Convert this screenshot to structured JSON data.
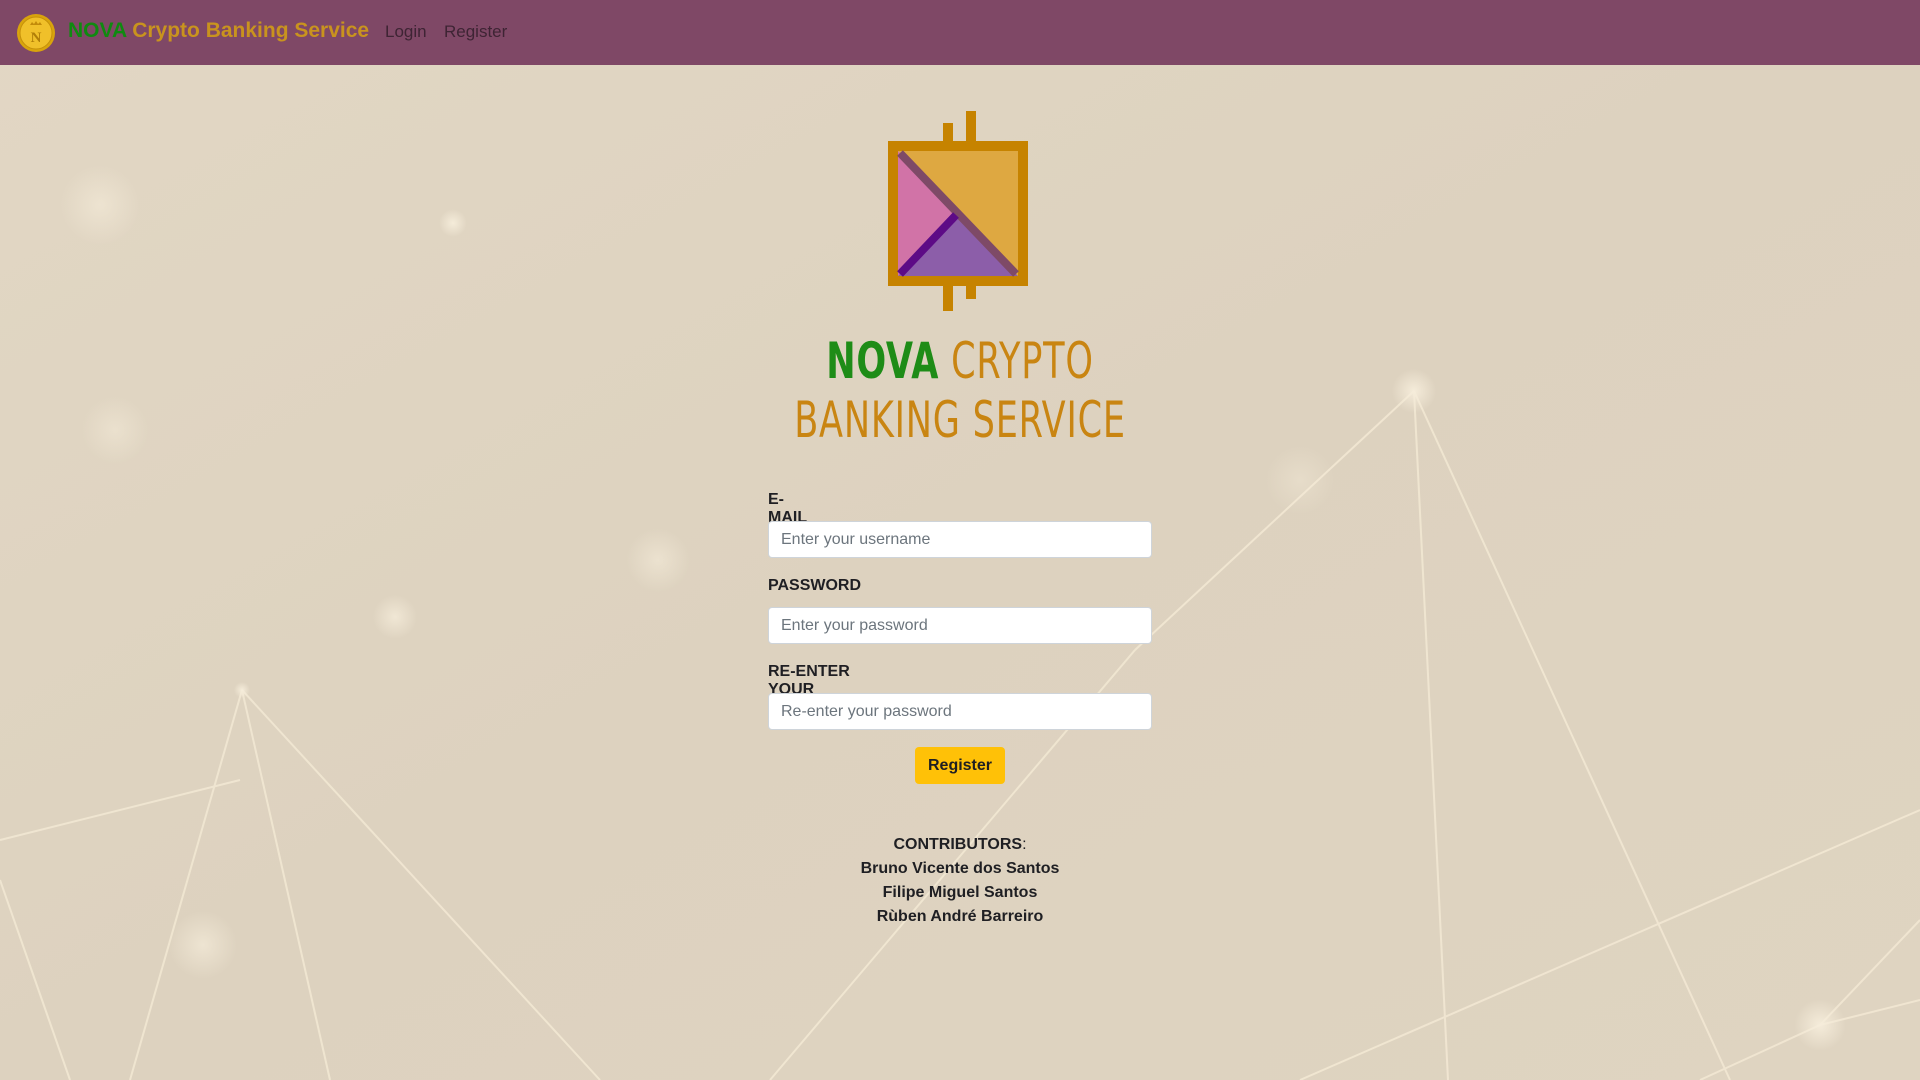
{
  "navbar": {
    "brand_first": "NOVA",
    "brand_rest": "Crypto Banking Service",
    "links": [
      {
        "label": "Login"
      },
      {
        "label": "Register"
      }
    ]
  },
  "hero": {
    "title_first": "NOVA",
    "title_line1_rest": "CRYPTO",
    "title_line2": "BANKING SERVICE"
  },
  "form": {
    "email": {
      "label": "E-MAIL",
      "placeholder": "Enter your username",
      "value": ""
    },
    "password": {
      "label": "PASSWORD",
      "placeholder": "Enter your password",
      "value": ""
    },
    "confirm": {
      "label": "RE-ENTER YOUR PASSWORD",
      "placeholder": "Re-enter your password",
      "value": ""
    },
    "submit_label": "Register"
  },
  "contributors": {
    "heading": "CONTRIBUTORS",
    "colon": ":",
    "names": [
      "Bruno Vicente dos Santos",
      "Filipe Miguel Santos",
      "Rùben André Barreiro"
    ]
  },
  "colors": {
    "navbar": "#7f4866",
    "brand_green": "#0f8a10",
    "brand_gold": "#c9931e",
    "button": "#ffc107",
    "background": "#ded3c0"
  },
  "icons": {
    "coin": "gold-coin-icon",
    "logo": "nova-logo-icon"
  }
}
